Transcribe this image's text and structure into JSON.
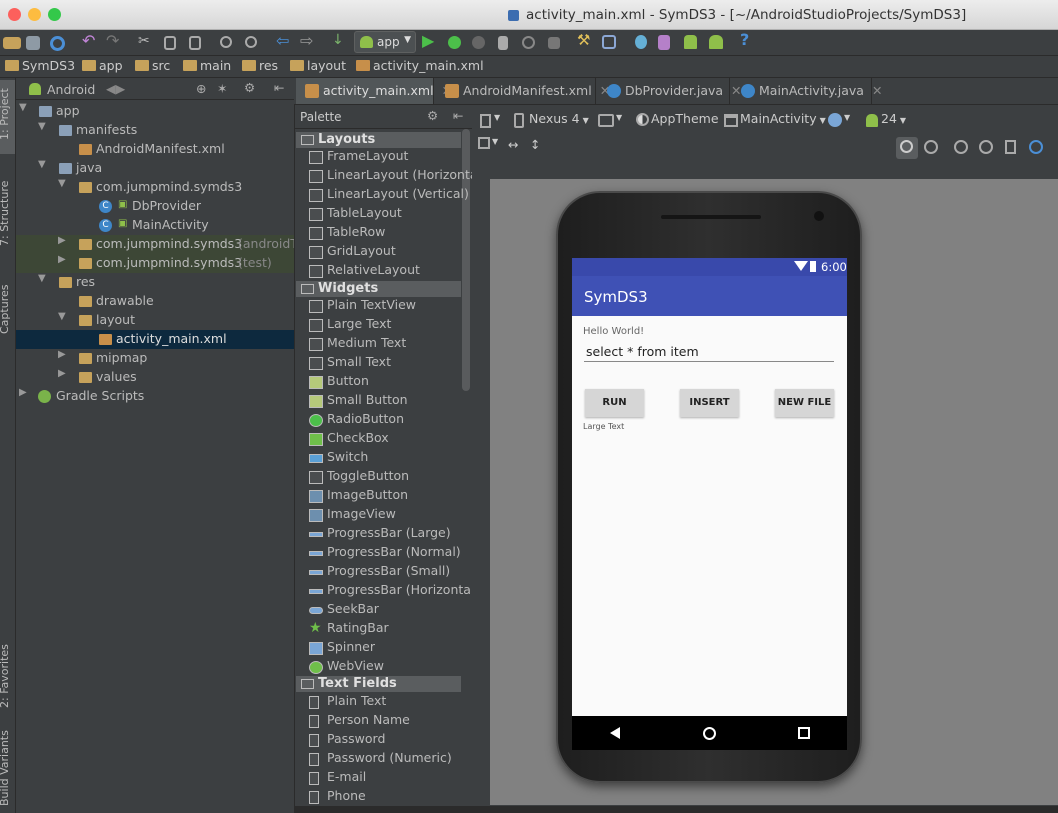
{
  "window": {
    "title": "activity_main.xml - SymDS3 - [~/AndroidStudioProjects/SymDS3]"
  },
  "toolbar": {
    "run_config": "app",
    "help": "?"
  },
  "breadcrumbs": [
    "SymDS3",
    "app",
    "src",
    "main",
    "res",
    "layout",
    "activity_main.xml"
  ],
  "left_strip": {
    "project": "1: Project",
    "structure": "7: Structure",
    "captures": "Captures",
    "favorites": "2: Favorites",
    "build_variants": "Build Variants"
  },
  "project_panel": {
    "view_selector": "Android",
    "tree": [
      {
        "label": "app",
        "suffix": ""
      },
      {
        "label": "manifests",
        "suffix": ""
      },
      {
        "label": "AndroidManifest.xml",
        "suffix": ""
      },
      {
        "label": "java",
        "suffix": ""
      },
      {
        "label": "com.jumpmind.symds3",
        "suffix": ""
      },
      {
        "label": "DbProvider",
        "suffix": ""
      },
      {
        "label": "MainActivity",
        "suffix": ""
      },
      {
        "label": "com.jumpmind.symds3",
        "suffix": "(androidT"
      },
      {
        "label": "com.jumpmind.symds3",
        "suffix": "(test)"
      },
      {
        "label": "res",
        "suffix": ""
      },
      {
        "label": "drawable",
        "suffix": ""
      },
      {
        "label": "layout",
        "suffix": ""
      },
      {
        "label": "activity_main.xml",
        "suffix": ""
      },
      {
        "label": "mipmap",
        "suffix": ""
      },
      {
        "label": "values",
        "suffix": ""
      },
      {
        "label": "Gradle Scripts",
        "suffix": ""
      }
    ]
  },
  "editor_tabs": [
    "activity_main.xml",
    "AndroidManifest.xml",
    "DbProvider.java",
    "MainActivity.java"
  ],
  "palette": {
    "title": "Palette",
    "groups": [
      {
        "name": "Layouts",
        "items": [
          "FrameLayout",
          "LinearLayout (Horizonta",
          "LinearLayout (Vertical)",
          "TableLayout",
          "TableRow",
          "GridLayout",
          "RelativeLayout"
        ]
      },
      {
        "name": "Widgets",
        "items": [
          "Plain TextView",
          "Large Text",
          "Medium Text",
          "Small Text",
          "Button",
          "Small Button",
          "RadioButton",
          "CheckBox",
          "Switch",
          "ToggleButton",
          "ImageButton",
          "ImageView",
          "ProgressBar (Large)",
          "ProgressBar (Normal)",
          "ProgressBar (Small)",
          "ProgressBar (Horizonta",
          "SeekBar",
          "RatingBar",
          "Spinner",
          "WebView"
        ]
      },
      {
        "name": "Text Fields",
        "items": [
          "Plain Text",
          "Person Name",
          "Password",
          "Password (Numeric)",
          "E-mail",
          "Phone"
        ]
      }
    ]
  },
  "designer_toolbar": {
    "device": "Nexus 4",
    "theme": "AppTheme",
    "activity": "MainActivity",
    "api": "24"
  },
  "device_screen": {
    "time": "6:00",
    "app_title": "SymDS3",
    "hello": "Hello World!",
    "query_text": "select * from item",
    "buttons": [
      "RUN",
      "INSERT",
      "NEW FILE"
    ],
    "large_text": "Large Text"
  },
  "colors": {
    "primary": "#3f51b5",
    "primary_dark": "#3949ab",
    "ide_bg": "#3c3f41",
    "selection": "#0d293e"
  }
}
